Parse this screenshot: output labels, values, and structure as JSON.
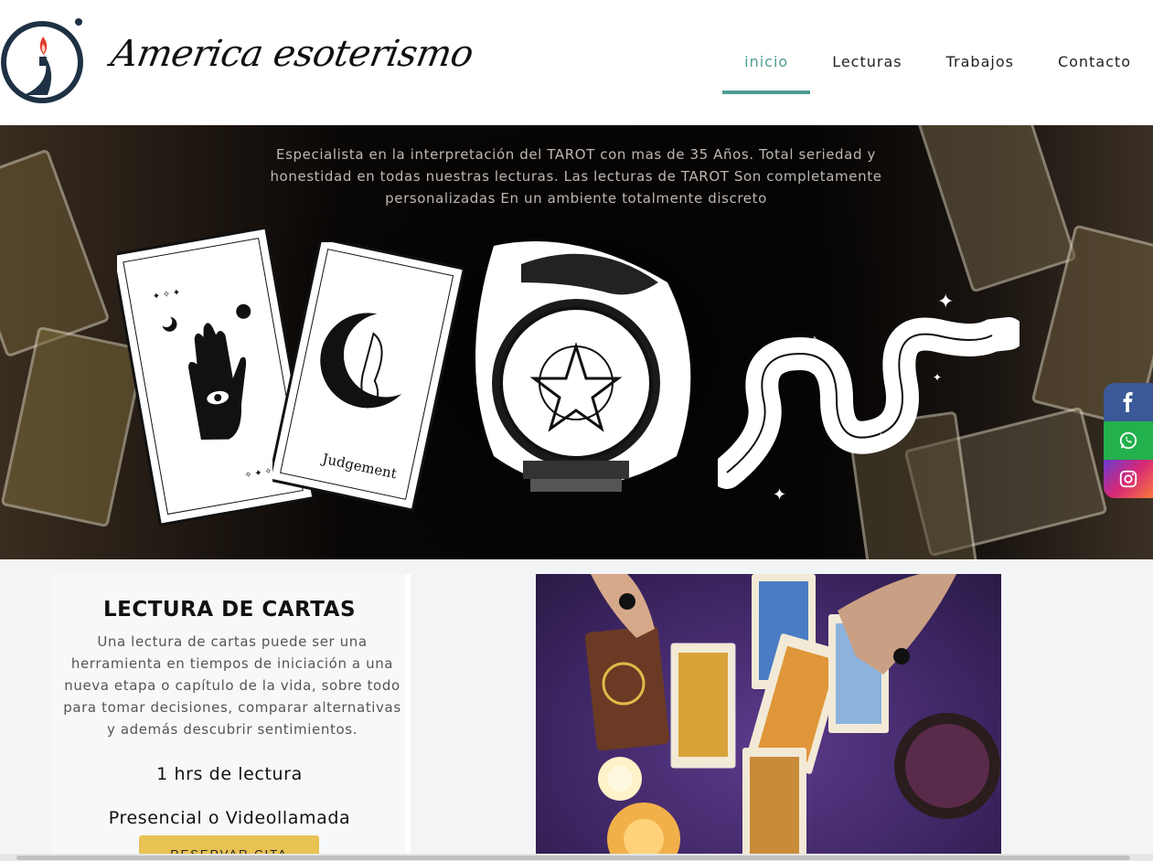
{
  "header": {
    "brand": "America esoterismo",
    "nav": [
      {
        "label": "inicio",
        "active": true
      },
      {
        "label": "Lecturas",
        "active": false
      },
      {
        "label": "Trabajos",
        "active": false
      },
      {
        "label": "Contacto",
        "active": false
      }
    ]
  },
  "hero": {
    "intro": "Especialista en la interpretación del TAROT con mas de 35 Años. Total seriedad y honestidad en todas nuestras lecturas. Las lecturas de TAROT Son completamente personalizadas En un ambiente totalmente discreto",
    "card_label": "Judgement"
  },
  "social": [
    {
      "name": "facebook-icon",
      "glyph": "f"
    },
    {
      "name": "whatsapp-icon",
      "glyph": "☏"
    },
    {
      "name": "instagram-icon",
      "glyph": "◎"
    }
  ],
  "reading": {
    "title": "LECTURA DE CARTAS",
    "description": "Una lectura de cartas puede ser una herramienta en tiempos de iniciación a una nueva etapa o capítulo de la vida, sobre todo para tomar decisiones, comparar alternativas y además descubrir sentimientos.",
    "duration": "1 hrs de lectura",
    "mode": "Presencial o Videollamada",
    "button": "RESERVAR CITA"
  },
  "colors": {
    "accent": "#4d9d93",
    "button": "#e8c252",
    "facebook": "#3b5998",
    "whatsapp": "#22b14c"
  }
}
